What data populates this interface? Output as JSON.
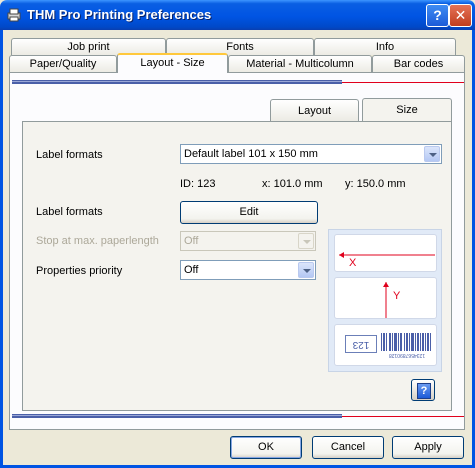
{
  "window": {
    "title": "THM Pro Printing Preferences",
    "help_glyph": "?",
    "close_glyph": "✕"
  },
  "tabs": {
    "row1": [
      "Job print",
      "Fonts",
      "Info"
    ],
    "row2": [
      "Paper/Quality",
      "Layout - Size",
      "Material - Multicolumn",
      "Bar codes"
    ],
    "active": "Layout - Size"
  },
  "inner_tabs": {
    "layout": "Layout",
    "size": "Size",
    "active": "Size"
  },
  "form": {
    "label_formats_label": "Label formats",
    "label_formats_value": "Default label 101 x 150 mm",
    "id_text": "ID: 123",
    "x_text": "x: 101.0 mm",
    "y_text": "y: 150.0 mm",
    "label_formats_label2": "Label formats",
    "edit_button": "Edit",
    "stop_label": "Stop at max. paperlength",
    "stop_value": "Off",
    "priority_label": "Properties priority",
    "priority_value": "Off"
  },
  "preview": {
    "x_marker": "X",
    "y_marker": "Y",
    "label_number": "123",
    "barcode_text": "1234567890128"
  },
  "footer": {
    "ok": "OK",
    "cancel": "Cancel",
    "apply": "Apply"
  },
  "colors": {
    "titlebar": "#0054e3",
    "accent_red": "#e0001c",
    "tab_highlight": "#ffc83c"
  },
  "icons": [
    "printer-icon",
    "help-icon",
    "close-icon",
    "dropdown-arrow-icon",
    "help-book-icon"
  ]
}
